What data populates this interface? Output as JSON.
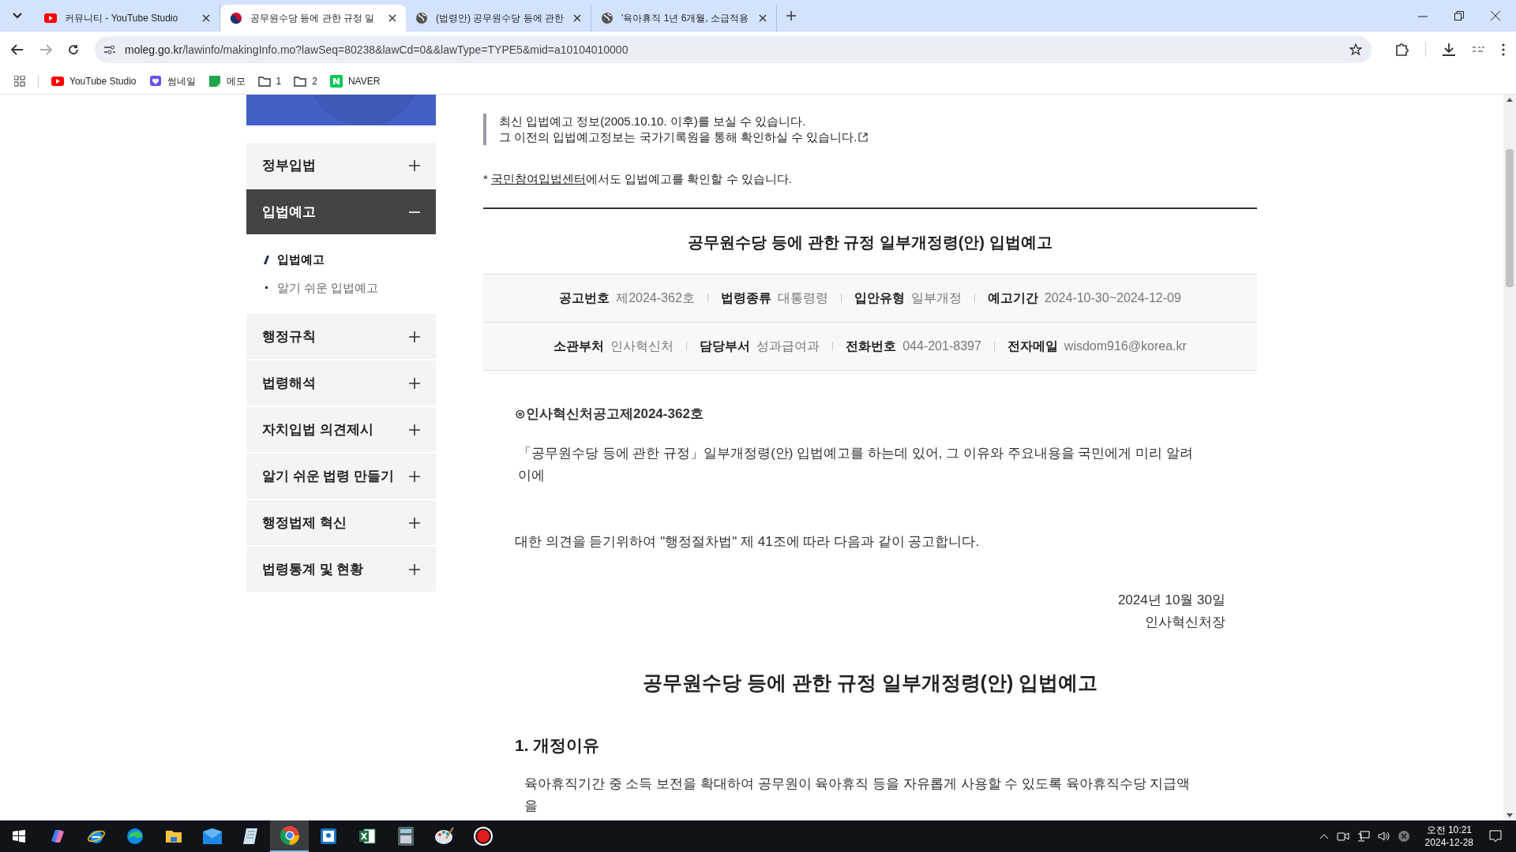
{
  "browser": {
    "tabs": [
      {
        "title": "커뮤니티 - YouTube Studio",
        "kind": "youtube",
        "selected": false
      },
      {
        "title": "공무원수당 등에 관한 규정 일",
        "kind": "gov",
        "selected": true
      },
      {
        "title": "(법령안) 공무원수당 등에 관한",
        "kind": "globe",
        "selected": false
      },
      {
        "title": "'육아휴직 1년 6개월, 소급적용",
        "kind": "globe",
        "selected": false
      }
    ],
    "url_host": "moleg.go.kr",
    "url_path": "/lawinfo/makingInfo.mo?lawSeq=80238&lawCd=0&&lawType=TYPE5&mid=a10104010000",
    "bookmarks": [
      {
        "label": "YouTube Studio",
        "kind": "youtube"
      },
      {
        "label": "썸네일",
        "kind": "heart"
      },
      {
        "label": "메모",
        "kind": "memo"
      },
      {
        "label": "1",
        "kind": "folder"
      },
      {
        "label": "2",
        "kind": "folder"
      },
      {
        "label": "NAVER",
        "kind": "naver"
      }
    ]
  },
  "sidebar": {
    "items": [
      {
        "label": "정부입법",
        "expanded": false
      },
      {
        "label": "입법예고",
        "expanded": true,
        "children": [
          {
            "label": "입법예고",
            "selected": true
          },
          {
            "label": "알기 쉬운 입법예고",
            "selected": false
          }
        ]
      },
      {
        "label": "행정규칙",
        "expanded": false
      },
      {
        "label": "법령해석",
        "expanded": false
      },
      {
        "label": "자치입법 의견제시",
        "expanded": false
      },
      {
        "label": "알기 쉬운 법령 만들기",
        "expanded": false
      },
      {
        "label": "행정법제 혁신",
        "expanded": false
      },
      {
        "label": "법령통계 및 현황",
        "expanded": false
      }
    ]
  },
  "notice": {
    "lines": [
      "최신 입법예고 정보(2005.10.10. 이후)를 보실 수 있습니다.",
      "그 이전의 입법예고정보는 국가기록원을 통해 확인하실 수 있습니다."
    ]
  },
  "note": {
    "prefix": "*",
    "link": "국민참여입법센터",
    "rest": "에서도 입법예고를 확인할 수 있습니다."
  },
  "article": {
    "title": "공무원수당 등에 관한 규정 일부개정령(안) 입법예고",
    "info_rows": [
      [
        {
          "label": "공고번호",
          "value": "제2024-362호"
        },
        {
          "label": "법령종류",
          "value": "대통령령"
        },
        {
          "label": "입안유형",
          "value": "일부개정"
        },
        {
          "label": "예고기간",
          "value": "2024-10-30~2024-12-09"
        }
      ],
      [
        {
          "label": "소관부처",
          "value": "인사혁신처"
        },
        {
          "label": "담당부서",
          "value": "성과급여과"
        },
        {
          "label": "전화번호",
          "value": "044-201-8397"
        },
        {
          "label": "전자메일",
          "value": "wisdom916@korea.kr"
        }
      ]
    ],
    "notice_number": "⊙인사혁신처공고제2024-362호",
    "paragraphs": [
      "「공무원수당 등에 관한 규정」일부개정령(안) 입법예고를 하는데 있어, 그 이유와 주요내용을 국민에게 미리 알려 이에",
      "대한 의견을 듣기위하여 \"행정절차법\" 제 41조에 따라 다음과 같이 공고합니다."
    ],
    "date": "2024년 10월 30일",
    "signer": "인사혁신처장",
    "heading": "공무원수당 등에 관한 규정 일부개정령(안) 입법예고",
    "section_heading": "1. 개정이유",
    "section_text": "육아휴직기간 중 소득 보전을 확대하여 공무원이 육아휴직 등을 자유롭게 사용할 수 있도록 육아휴직수당 지급액을"
  },
  "taskbar": {
    "apps": [
      {
        "kind": "copilot",
        "active": false
      },
      {
        "kind": "ie",
        "active": false
      },
      {
        "kind": "edge",
        "active": false
      },
      {
        "kind": "explorer",
        "active": false
      },
      {
        "kind": "mail",
        "active": false
      },
      {
        "kind": "notepad",
        "active": false
      },
      {
        "kind": "chrome",
        "active": true
      },
      {
        "kind": "app",
        "active": false
      },
      {
        "kind": "excel",
        "active": false
      },
      {
        "kind": "calculator",
        "active": false
      },
      {
        "kind": "paint",
        "active": false
      },
      {
        "kind": "record",
        "active": false
      }
    ],
    "time": "오전 10:21",
    "date": "2024-12-28"
  }
}
